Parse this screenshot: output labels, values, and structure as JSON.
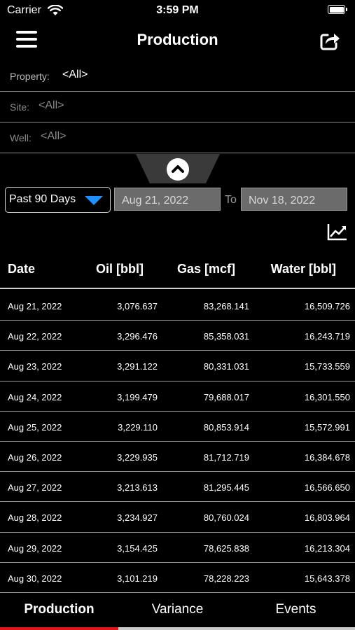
{
  "status": {
    "carrier": "Carrier",
    "time": "3:59 PM"
  },
  "nav": {
    "title": "Production"
  },
  "filters": {
    "property": {
      "label": "Property:",
      "value": "<All>"
    },
    "site": {
      "label": "Site:",
      "value": "<All>"
    },
    "well": {
      "label": "Well:",
      "value": "<All>"
    }
  },
  "dates": {
    "range": "Past 90 Days",
    "from": "Aug 21, 2022",
    "to_label": "To",
    "to": "Nov 18, 2022"
  },
  "table": {
    "headers": {
      "date": "Date",
      "oil": "Oil [bbl]",
      "gas": "Gas [mcf]",
      "water": "Water [bbl]"
    },
    "rows": [
      {
        "date": "Aug 21, 2022",
        "oil": "3,076.637",
        "gas": "83,268.141",
        "water": "16,509.726"
      },
      {
        "date": "Aug 22, 2022",
        "oil": "3,296.476",
        "gas": "85,358.031",
        "water": "16,243.719"
      },
      {
        "date": "Aug 23, 2022",
        "oil": "3,291.122",
        "gas": "80,331.031",
        "water": "15,733.559"
      },
      {
        "date": "Aug 24, 2022",
        "oil": "3,199.479",
        "gas": "79,688.017",
        "water": "16,301.550"
      },
      {
        "date": "Aug 25, 2022",
        "oil": "3,229.110",
        "gas": "80,853.914",
        "water": "15,572.991"
      },
      {
        "date": "Aug 26, 2022",
        "oil": "3,229.935",
        "gas": "81,712.719",
        "water": "16,384.678"
      },
      {
        "date": "Aug 27, 2022",
        "oil": "3,213.613",
        "gas": "81,295.445",
        "water": "16,566.650"
      },
      {
        "date": "Aug 28, 2022",
        "oil": "3,234.927",
        "gas": "80,760.024",
        "water": "16,803.964"
      },
      {
        "date": "Aug 29, 2022",
        "oil": "3,154.425",
        "gas": "78,625.838",
        "water": "16,213.304"
      },
      {
        "date": "Aug 30, 2022",
        "oil": "3,101.219",
        "gas": "78,228.223",
        "water": "15,643.378"
      }
    ]
  },
  "tabs": [
    {
      "label": "Production"
    },
    {
      "label": "Variance"
    },
    {
      "label": "Events"
    }
  ],
  "colors": {
    "accent": "#e3141c",
    "dropdown_arrow": "#1e90ff",
    "background": "#000000"
  },
  "icons": {
    "menu": "hamburger-menu-icon",
    "share": "share-icon",
    "collapse": "chevron-up-icon",
    "dropdown": "triangle-down-icon",
    "chart": "line-chart-icon"
  }
}
